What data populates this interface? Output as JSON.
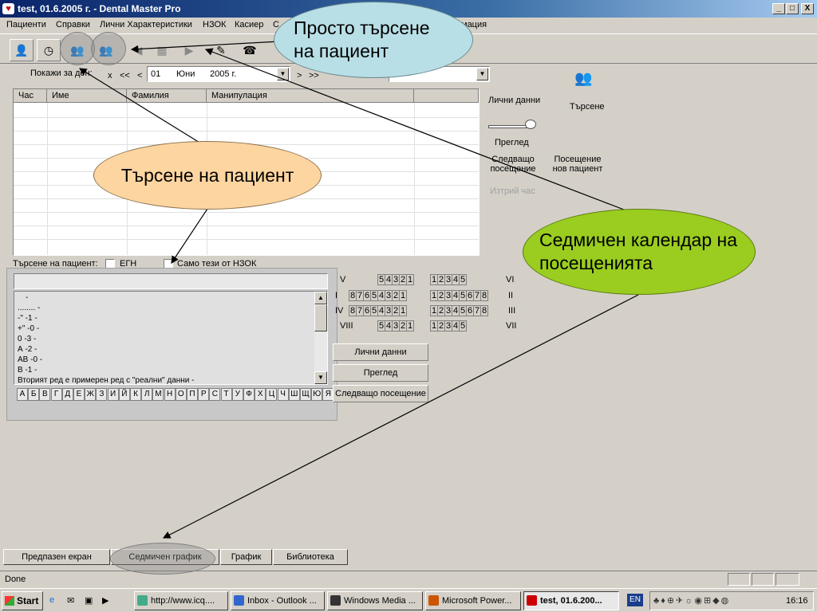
{
  "window": {
    "title": "test, 01.6.2005 г. - Dental Master Pro",
    "min": "_",
    "max": "□",
    "close": "X"
  },
  "menu": [
    "Пациенти",
    "Справки",
    "Лични Характеристики",
    "НЗОК",
    "Касиер",
    "С",
    "мация"
  ],
  "date_row": {
    "label": "Покажи за ден:",
    "x": "x",
    "prev2": "<<",
    "prev": "<",
    "day": "01",
    "month": "Юни",
    "year": "2005 г.",
    "next": ">",
    "next2": ">>",
    "combo": "..."
  },
  "grid": {
    "columns": [
      "Час",
      "Име",
      "Фамилия",
      "Манипулация"
    ]
  },
  "right_panel": {
    "personal": "Лични данни",
    "search": "Търсене",
    "exam": "Преглед",
    "next_visit": "Следващо посещение",
    "new_patient": "Посещение нов пациент",
    "delete_hour": "Изтрий час"
  },
  "search": {
    "label": "Търсене на пациент:",
    "egn": "ЕГН",
    "nzok_only": "Само тези от НЗОК",
    "input": "",
    "list": [
      "-",
      "........ -",
      "-\" -1 -",
      "+\" -0 -",
      "0 -3 -",
      "А -2 -",
      "АВ -0 -",
      "В -1 -",
      "Вторият ред е примерен ред с \"реални\" данни -"
    ],
    "alphabet": [
      "А",
      "Б",
      "В",
      "Г",
      "Д",
      "Е",
      "Ж",
      "З",
      "И",
      "Й",
      "К",
      "Л",
      "М",
      "Н",
      "О",
      "П",
      "Р",
      "С",
      "Т",
      "У",
      "Ф",
      "Х",
      "Ц",
      "Ч",
      "Ш",
      "Щ",
      "Ю",
      "Я"
    ]
  },
  "teeth": {
    "rows": [
      {
        "left_label": "V",
        "right_label": "VI",
        "left": [
          "5",
          "4",
          "3",
          "2",
          "1"
        ],
        "right": [
          "1",
          "2",
          "3",
          "4",
          "5"
        ]
      },
      {
        "left_label": "I",
        "right_label": "II",
        "left": [
          "8",
          "7",
          "6",
          "5",
          "4",
          "3",
          "2",
          "1"
        ],
        "right": [
          "1",
          "2",
          "3",
          "4",
          "5",
          "6",
          "7",
          "8"
        ]
      },
      {
        "left_label": "IV",
        "right_label": "III",
        "left": [
          "8",
          "7",
          "6",
          "5",
          "4",
          "3",
          "2",
          "1"
        ],
        "right": [
          "1",
          "2",
          "3",
          "4",
          "5",
          "6",
          "7",
          "8"
        ]
      },
      {
        "left_label": "VIII",
        "right_label": "VII",
        "left": [
          "5",
          "4",
          "3",
          "2",
          "1"
        ],
        "right": [
          "1",
          "2",
          "3",
          "4",
          "5"
        ]
      }
    ]
  },
  "side_buttons": [
    "Лични данни",
    "Преглед",
    "Следващо посещение"
  ],
  "tabs": [
    "Предпазен екран",
    "Седмичен график",
    "График",
    "Библиотека"
  ],
  "status": "Done",
  "taskbar": {
    "start": "Start",
    "tasks": [
      "http://www.icq....",
      "Inbox - Outlook ...",
      "Windows Media ...",
      "Microsoft Power...",
      "test, 01.6.200..."
    ],
    "lang": "EN",
    "clock": "16:16"
  },
  "callouts": {
    "simple_search": "Просто търсене на пациент",
    "patient_search": "Търсене на пациент",
    "weekly_calendar": "Седмичен календар на посещенията"
  },
  "colors": {
    "titlebar": "#0a246a",
    "callout_blue": "#b9dfe6",
    "callout_orange": "#fdd5a0",
    "callout_green": "#9acd1f"
  }
}
